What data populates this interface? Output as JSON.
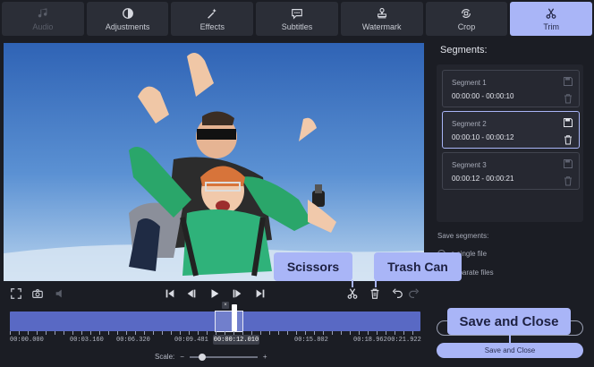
{
  "tabs": [
    {
      "label": "Audio",
      "icon": "music-note-icon"
    },
    {
      "label": "Adjustments",
      "icon": "contrast-icon"
    },
    {
      "label": "Effects",
      "icon": "magic-wand-icon"
    },
    {
      "label": "Subtitles",
      "icon": "speech-bubble-icon"
    },
    {
      "label": "Watermark",
      "icon": "stamp-icon"
    },
    {
      "label": "Crop",
      "icon": "crop-rotate-icon"
    },
    {
      "label": "Trim",
      "icon": "scissors-icon"
    }
  ],
  "active_tab": "Trim",
  "segments_panel": {
    "title": "Segments:",
    "items": [
      {
        "name": "Segment 1",
        "range": "00:00:00 - 00:00:10"
      },
      {
        "name": "Segment 2",
        "range": "00:00:10 - 00:00:12"
      },
      {
        "name": "Segment 3",
        "range": "00:00:12 - 00:00:21"
      }
    ],
    "selected_index": 1
  },
  "save_segments": {
    "label": "Save segments:",
    "options": [
      "a single file",
      "separate files"
    ]
  },
  "timeline": {
    "labels": [
      "00:00.000",
      "00:03.160",
      "00:06.320",
      "00:09.481",
      "00:15.802",
      "00:18.962",
      "00:21.922"
    ],
    "current_time": "00:00:12.010",
    "scale_label": "Scale:",
    "scale_minus": "−",
    "scale_plus": "+"
  },
  "buttons": {
    "save_and_close": "Save and Close"
  },
  "callouts": {
    "scissors": "Scissors",
    "trash_can": "Trash Can",
    "save_and_close": "Save and Close"
  },
  "colors": {
    "accent": "#a9b5f7",
    "background": "#1b1d24",
    "panel": "#2b2e37",
    "timeline": "#5969c4"
  }
}
